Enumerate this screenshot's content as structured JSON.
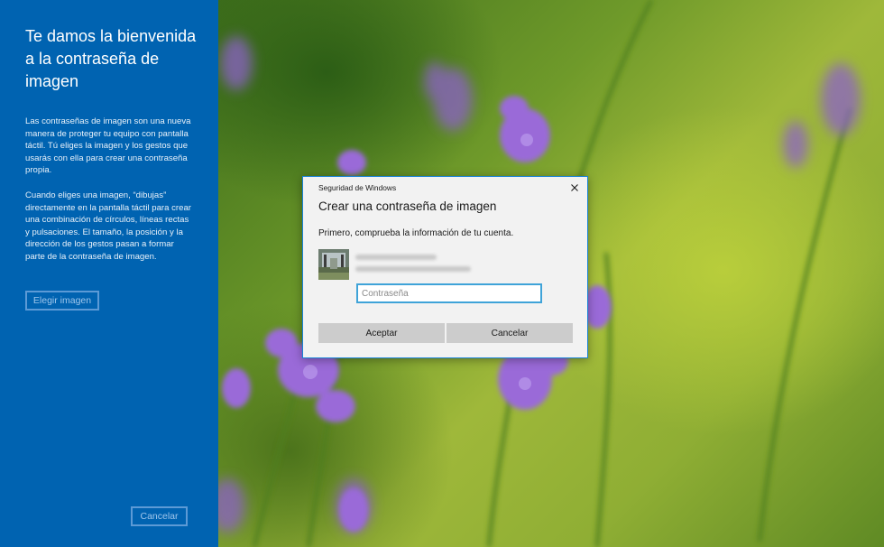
{
  "sidebar": {
    "title": "Te damos la bienvenida a la contraseña de imagen",
    "paragraph_1": "Las contraseñas de imagen son una nueva manera de proteger tu equipo con pantalla táctil. Tú eliges la imagen y los gestos que usarás con ella para crear una contraseña propia.",
    "paragraph_2": "Cuando eliges una imagen, “dibujas” directamente en la pantalla táctil para crear una combinación de círculos, líneas rectas y pulsaciones. El tamaño, la posición y la dirección de los gestos pasan a formar parte de la contraseña de imagen.",
    "choose_image_label": "Elegir imagen",
    "cancel_label": "Cancelar"
  },
  "dialog": {
    "caption": "Seguridad de Windows",
    "title": "Crear una contraseña de imagen",
    "instruction": "Primero, comprueba la información de tu cuenta.",
    "password_placeholder": "Contraseña",
    "password_value": "",
    "accept_label": "Aceptar",
    "cancel_label": "Cancelar",
    "close_icon": "close-icon",
    "accent_color": "#1883d7"
  },
  "colors": {
    "sidebar_background": "#0063b1",
    "button_gray": "#cccccc"
  }
}
